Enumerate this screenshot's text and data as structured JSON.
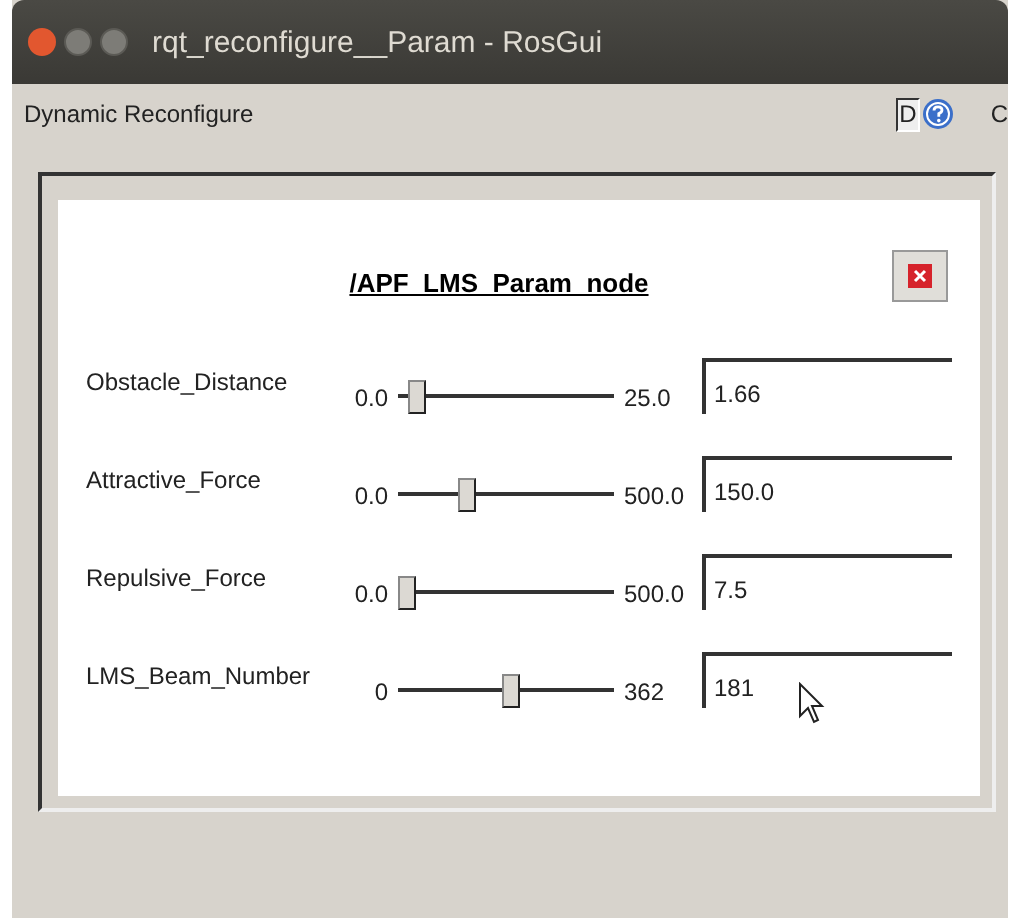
{
  "window": {
    "title": "rqt_reconfigure__Param - RosGui"
  },
  "toolbar": {
    "title": "Dynamic Reconfigure",
    "d_button": "D",
    "cut_label": "C"
  },
  "node": {
    "title": "/APF_LMS_Param_node"
  },
  "params": [
    {
      "name": "Obstacle_Distance",
      "min": "0.0",
      "max": "25.0",
      "value": "1.66",
      "level": 0.066
    },
    {
      "name": "Attractive_Force",
      "min": "0.0",
      "max": "500.0",
      "value": "150.0",
      "level": 0.3
    },
    {
      "name": "Repulsive_Force",
      "min": "0.0",
      "max": "500.0",
      "value": "7.5",
      "level": 0.015
    },
    {
      "name": "LMS_Beam_Number",
      "min": "0",
      "max": "362",
      "value": "181",
      "level": 0.5
    }
  ]
}
